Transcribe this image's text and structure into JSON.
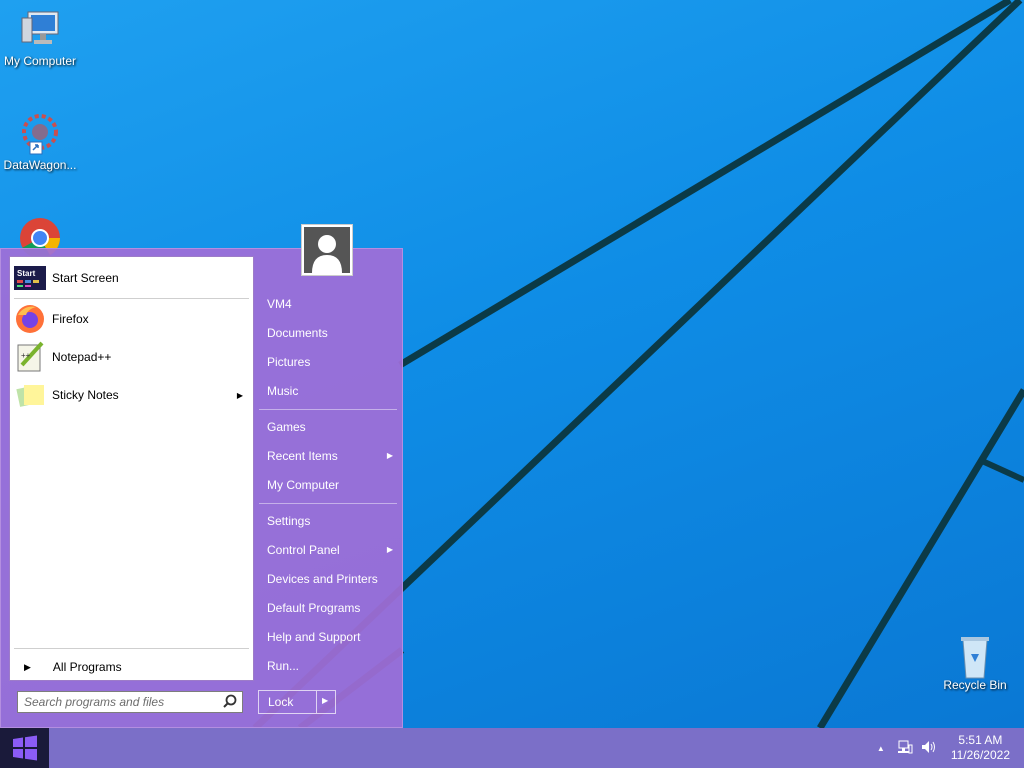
{
  "desktop": {
    "icons": [
      {
        "label": "My Computer",
        "icon": "computer-icon"
      },
      {
        "label": "DataWagon...",
        "icon": "datawagon-icon"
      },
      {
        "label": "Google Chrome",
        "icon": "chrome-icon"
      },
      {
        "label": "Recycle Bin",
        "icon": "recycle-bin-icon"
      }
    ]
  },
  "start_menu": {
    "programs": [
      {
        "label": "Start Screen",
        "icon": "start-screen-icon"
      },
      {
        "label": "Firefox",
        "icon": "firefox-icon"
      },
      {
        "label": "Notepad++",
        "icon": "notepadpp-icon"
      },
      {
        "label": "Sticky Notes",
        "icon": "sticky-notes-icon"
      }
    ],
    "start_screen_tile_text": "Start",
    "all_programs": "All Programs",
    "search_placeholder": "Search programs and files",
    "right_items": [
      {
        "label": "VM4"
      },
      {
        "label": "Documents"
      },
      {
        "label": "Pictures"
      },
      {
        "label": "Music"
      },
      {
        "label": "Games"
      },
      {
        "label": "Recent Items",
        "submenu": true
      },
      {
        "label": "My Computer"
      },
      {
        "label": "Settings"
      },
      {
        "label": "Control Panel",
        "submenu": true
      },
      {
        "label": "Devices and Printers"
      },
      {
        "label": "Default Programs"
      },
      {
        "label": "Help and Support"
      },
      {
        "label": "Run..."
      }
    ],
    "lock_label": "Lock"
  },
  "taskbar": {
    "time": "5:51 AM",
    "date": "11/26/2022"
  },
  "colors": {
    "desktop_bg": "#1296e8",
    "start_menu_bg": "#a06ed7",
    "taskbar_bg": "#7b6fc8"
  }
}
